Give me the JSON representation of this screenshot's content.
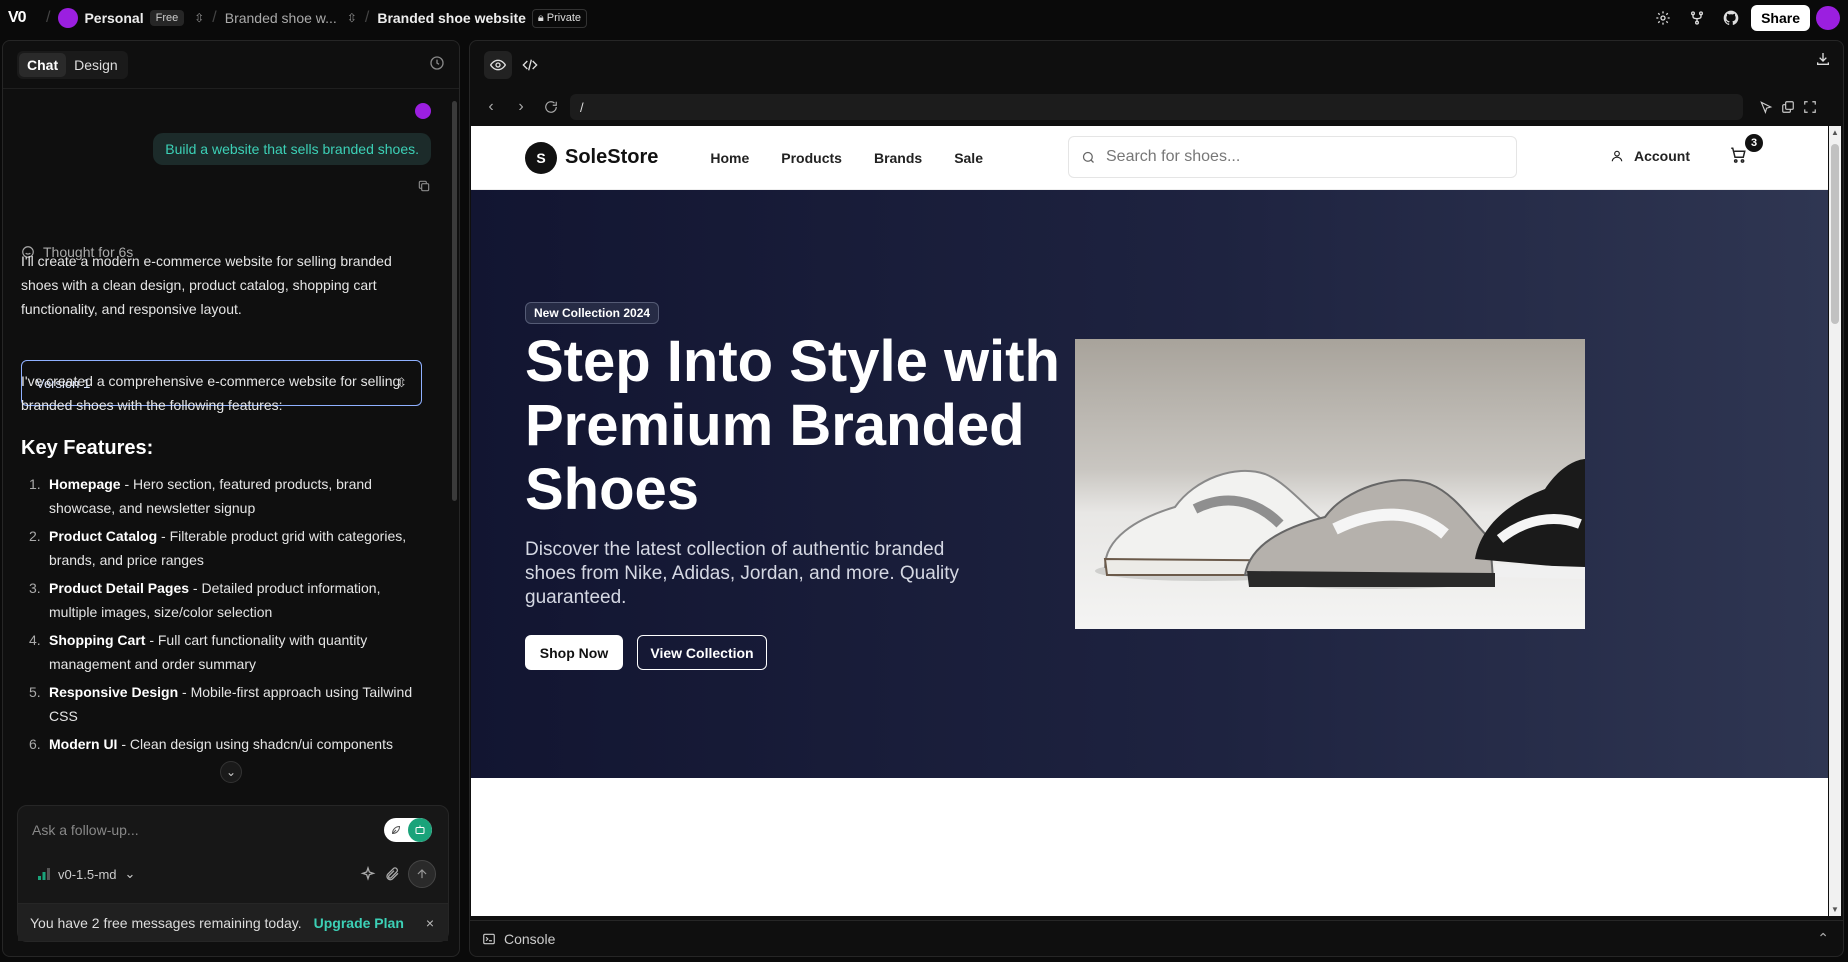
{
  "topbar": {
    "logo": "V0",
    "workspace": "Personal",
    "plan_badge": "Free",
    "project_short": "Branded shoe w...",
    "project_title": "Branded shoe website",
    "privacy": "Private",
    "share_label": "Share"
  },
  "left": {
    "tabs": [
      "Chat",
      "Design"
    ],
    "user_message": "Build a website that sells branded shoes.",
    "thought": "Thought for 6s",
    "intro": "I'll create a modern e-commerce website for selling branded shoes with a clean design, product catalog, shopping cart functionality, and responsive layout.",
    "version_label": "Version 1",
    "summary": "I've created a comprehensive e-commerce website for selling branded shoes with the following features:",
    "features_heading": "Key Features:",
    "features": [
      {
        "num": "1.",
        "title": "Homepage",
        "desc": " - Hero section, featured products, brand showcase, and newsletter signup"
      },
      {
        "num": "2.",
        "title": "Product Catalog",
        "desc": " - Filterable product grid with categories, brands, and price ranges"
      },
      {
        "num": "3.",
        "title": "Product Detail Pages",
        "desc": " - Detailed product information, multiple images, size/color selection"
      },
      {
        "num": "4.",
        "title": "Shopping Cart",
        "desc": " - Full cart functionality with quantity management and order summary"
      },
      {
        "num": "5.",
        "title": "Responsive Design",
        "desc": " - Mobile-first approach using Tailwind CSS"
      },
      {
        "num": "6.",
        "title": "Modern UI",
        "desc": " - Clean design using shadcn/ui components"
      }
    ],
    "composer_placeholder": "Ask a follow-up...",
    "model": "v0-1.5-md",
    "notice": "You have 2 free messages remaining today.",
    "upgrade_label": "Upgrade Plan"
  },
  "preview": {
    "url": "/",
    "console_label": "Console"
  },
  "site": {
    "logo_mark": "S",
    "brand": "SoleStore",
    "nav": [
      "Home",
      "Products",
      "Brands",
      "Sale"
    ],
    "search_placeholder": "Search for shoes...",
    "account_label": "Account",
    "cart_count": "3",
    "hero_pill": "New Collection 2024",
    "hero_title": "Step Into Style with Premium Branded Shoes",
    "hero_subtitle": "Discover the latest collection of authentic branded shoes from Nike, Adidas, Jordan, and more. Quality guaranteed.",
    "btn_primary": "Shop Now",
    "btn_secondary": "View Collection"
  },
  "colors": {
    "accent_teal": "#3cd0b6",
    "avatar_purple": "#9b1fe0",
    "hero_dark": "#121531"
  }
}
